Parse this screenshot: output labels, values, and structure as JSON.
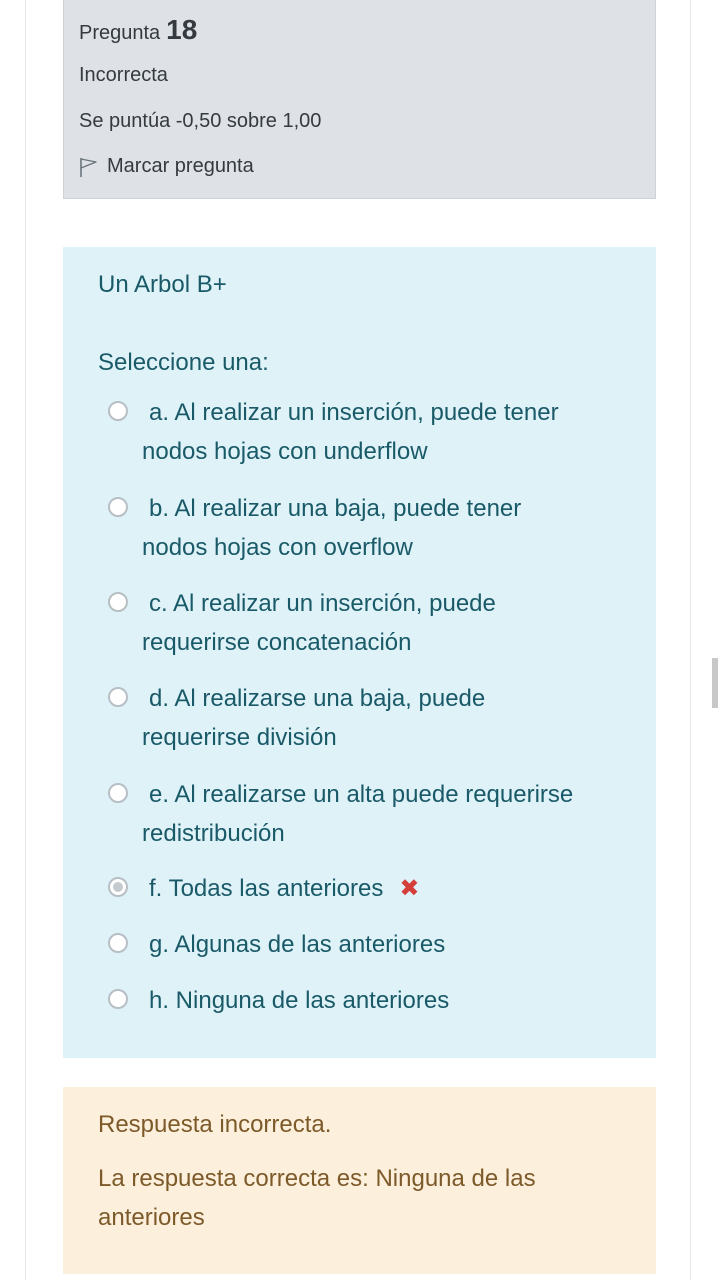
{
  "info": {
    "question_label": "Pregunta",
    "question_number": "18",
    "state": "Incorrecta",
    "grade": "Se puntúa -0,50 sobre 1,00",
    "flag_label": "Marcar pregunta"
  },
  "question": {
    "text": "Un Arbol B+",
    "prompt": "Seleccione una:",
    "options": [
      {
        "label": "a. Al realizar un inserción, puede tener",
        "label2": "nodos hojas con underflow",
        "selected": false
      },
      {
        "label": "b. Al realizar una baja, puede tener",
        "label2": "nodos hojas con overflow",
        "selected": false
      },
      {
        "label": "c. Al realizar un inserción, puede",
        "label2": "requerirse concatenación",
        "selected": false
      },
      {
        "label": "d. Al realizarse una baja, puede",
        "label2": "requerirse división",
        "selected": false
      },
      {
        "label": "e. Al realizarse un alta puede requerirse",
        "label2": "redistribución",
        "selected": false
      },
      {
        "label": "f. Todas las anteriores",
        "selected": true,
        "mark": "✖"
      },
      {
        "label": "g. Algunas de las anteriores",
        "selected": false
      },
      {
        "label": "h. Ninguna de las anteriores",
        "selected": false
      }
    ]
  },
  "feedback": {
    "title": "Respuesta incorrecta.",
    "answer": "La respuesta correcta es: Ninguna de las anteriores"
  },
  "colors": {
    "info_bg": "#dee2e6",
    "question_bg": "#def2f8",
    "question_text": "#1a5a68",
    "feedback_bg": "#fcefdc",
    "feedback_text": "#7d5a29",
    "wrong_mark": "#d43f3a"
  },
  "icons": {
    "flag": "flag-outline-icon",
    "wrong": "cross-icon"
  }
}
